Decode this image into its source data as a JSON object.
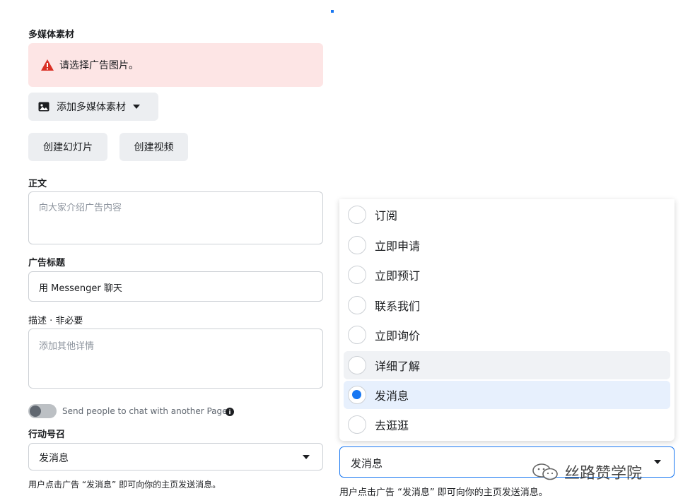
{
  "media": {
    "section_label": "多媒体素材",
    "alert_text": "请选择广告图片。",
    "add_media_label": "添加多媒体素材",
    "slideshow_label": "创建幻灯片",
    "video_label": "创建视频"
  },
  "primary_text": {
    "label": "正文",
    "placeholder": "向大家介绍广告内容"
  },
  "headline": {
    "label": "广告标题",
    "value": "用 Messenger 聊天"
  },
  "description": {
    "label": "描述 · 非必要",
    "placeholder": "添加其他详情"
  },
  "chat_toggle": {
    "label": "Send people to chat with another Page",
    "checked": false
  },
  "cta": {
    "label": "行动号召",
    "value": "发消息",
    "hint": "用户点击广告 “发消息” 即可向你的主页发送消息。"
  },
  "cta_dropdown": {
    "options": [
      "订阅",
      "立即申请",
      "立即预订",
      "联系我们",
      "立即询价",
      "详细了解",
      "发消息",
      "去逛逛"
    ],
    "hovered": "详细了解",
    "selected": "发消息",
    "value": "发消息",
    "hint": "用户点击广告 “发消息” 即可向你的主页发送消息。"
  },
  "watermark": {
    "text": "丝路赞学院"
  },
  "colors": {
    "accent": "#1877f2",
    "alert_bg": "#fde5e5",
    "alert_icon": "#d93025"
  }
}
